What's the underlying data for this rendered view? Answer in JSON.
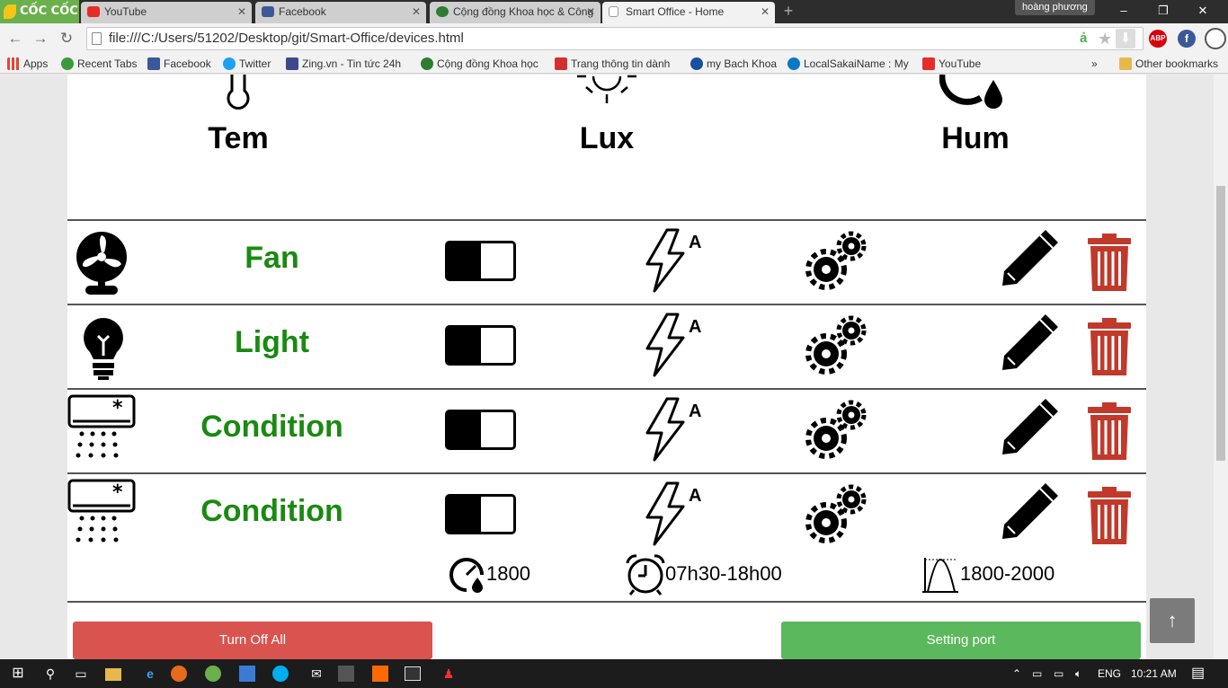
{
  "browser": {
    "logo": "CỐC CỐC",
    "tabs": [
      {
        "label": "YouTube",
        "color": "#e52d27"
      },
      {
        "label": "Facebook",
        "color": "#3b5998"
      },
      {
        "label": "Cộng đồng Khoa học & Công",
        "color": "#2e7d32"
      },
      {
        "label": "Smart Office - Home",
        "color": "#888888"
      }
    ],
    "profile": "hoàng phương",
    "url": "file:///C:/Users/51202/Desktop/git/Smart-Office/devices.html",
    "extensions": {
      "abp": "ABP"
    }
  },
  "bookmarks": {
    "items": [
      {
        "label": "Apps",
        "color": "#e0453a"
      },
      {
        "label": "Recent Tabs",
        "color": "#3c9a3c"
      },
      {
        "label": "Facebook",
        "color": "#3b5998"
      },
      {
        "label": "Twitter",
        "color": "#1da1f2"
      },
      {
        "label": "Zing.vn - Tin tức 24h",
        "color": "#3a4a8c"
      },
      {
        "label": "Cộng đồng Khoa học",
        "color": "#2e7d32"
      },
      {
        "label": "Trang thông tin dành",
        "color": "#d32f2f"
      },
      {
        "label": "my Bach Khoa",
        "color": "#1a4fa0"
      },
      {
        "label": "LocalSakaiName : My",
        "color": "#0a78c2"
      },
      {
        "label": "YouTube",
        "color": "#e52d27"
      }
    ],
    "overflow": "»",
    "other": "Other bookmarks"
  },
  "sensors": [
    {
      "label": "Tem",
      "icon": "thermometer-icon"
    },
    {
      "label": "Lux",
      "icon": "sun-icon"
    },
    {
      "label": "Hum",
      "icon": "humidity-icon"
    }
  ],
  "devices": [
    {
      "name": "Fan",
      "icon": "fan-icon",
      "power": "off"
    },
    {
      "name": "Light",
      "icon": "lightbulb-icon",
      "power": "off"
    },
    {
      "name": "Condition",
      "icon": "air-conditioner-icon",
      "power": "off"
    },
    {
      "name": "Condition",
      "icon": "air-conditioner-icon",
      "power": "off"
    }
  ],
  "device_details": {
    "speed": "1800",
    "schedule": "07h30-18h00",
    "range": "1800-2000"
  },
  "actions": {
    "turn_off_all": "Turn Off All",
    "setting_port": "Setting port",
    "back_to_top": "↑"
  },
  "colors": {
    "device_name": "#1a8a12",
    "delete": "#c0392b",
    "turn_off_all": "#d9534f",
    "setting_port": "#5cb85c"
  },
  "taskbar": {
    "language": "ENG",
    "time": "10:21 AM"
  }
}
